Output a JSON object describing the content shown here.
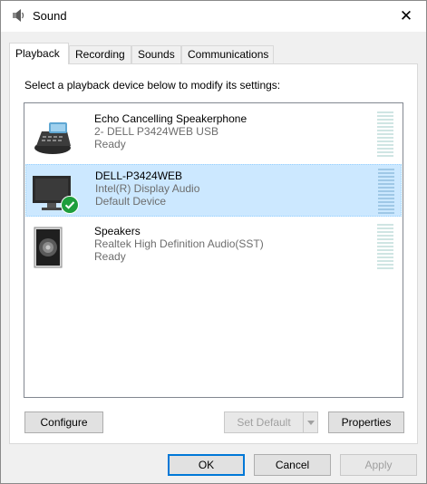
{
  "window": {
    "title": "Sound",
    "title_icon": "speaker-icon",
    "close_glyph": "✕"
  },
  "tabs": [
    {
      "label": "Playback",
      "active": true
    },
    {
      "label": "Recording",
      "active": false
    },
    {
      "label": "Sounds",
      "active": false
    },
    {
      "label": "Communications",
      "active": false
    }
  ],
  "playback": {
    "instruction": "Select a playback device below to modify its settings:",
    "devices": [
      {
        "name": "Echo Cancelling Speakerphone",
        "driver": "2- DELL P3424WEB USB",
        "status": "Ready",
        "icon": "speakerphone-icon",
        "selected": false
      },
      {
        "name": "DELL-P3424WEB",
        "driver": "Intel(R) Display Audio",
        "status": "Default Device",
        "icon": "monitor-icon",
        "selected": true,
        "default": true
      },
      {
        "name": "Speakers",
        "driver": "Realtek High Definition Audio(SST)",
        "status": "Ready",
        "icon": "speakers-icon",
        "selected": false
      }
    ],
    "buttons": {
      "configure": "Configure",
      "set_default": "Set Default",
      "properties": "Properties"
    }
  },
  "footer": {
    "ok": "OK",
    "cancel": "Cancel",
    "apply": "Apply"
  },
  "colors": {
    "selection": "#cce8ff",
    "accent": "#0078d7",
    "default_check": "#1e9e3c"
  }
}
